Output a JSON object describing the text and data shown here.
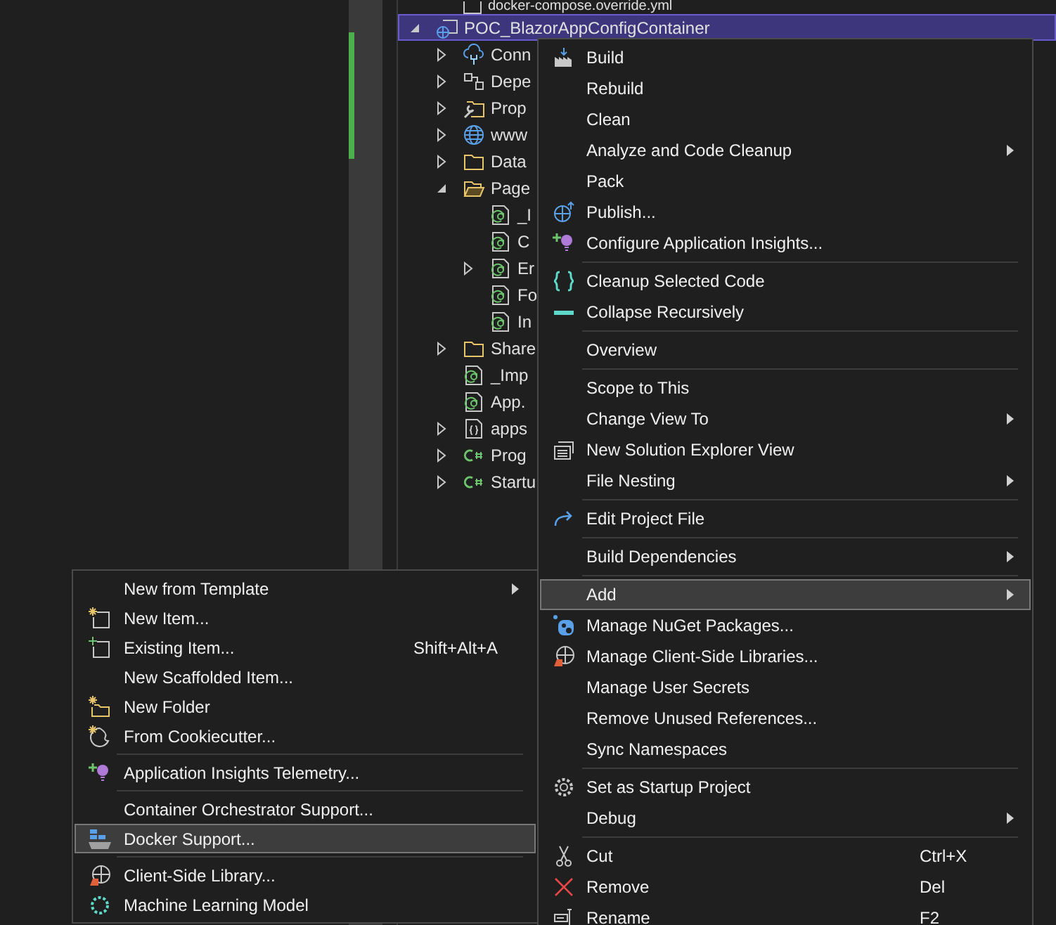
{
  "tree": {
    "items": [
      {
        "label": "docker-compose.override.yml",
        "kind": "yaml",
        "selected": false
      },
      {
        "label": "POC_BlazorAppConfigContainer",
        "kind": "project",
        "expanded": true,
        "selected": true,
        "children": [
          {
            "label": "Conn",
            "kind": "connected",
            "expanded": false,
            "selected": false
          },
          {
            "label": "Depe",
            "kind": "dependencies",
            "expanded": false,
            "selected": false
          },
          {
            "label": "Prop",
            "kind": "properties",
            "expanded": false,
            "selected": false
          },
          {
            "label": "www",
            "kind": "web",
            "expanded": false,
            "selected": false
          },
          {
            "label": "Data",
            "kind": "folder",
            "expanded": false,
            "selected": false
          },
          {
            "label": "Page",
            "kind": "folder-open",
            "expanded": true,
            "selected": false,
            "children": [
              {
                "label": "_I",
                "kind": "razor",
                "selected": false
              },
              {
                "label": "C",
                "kind": "razor",
                "selected": false
              },
              {
                "label": "Er",
                "kind": "razor",
                "expanded": false,
                "selected": false
              },
              {
                "label": "Fo",
                "kind": "razor",
                "selected": false
              },
              {
                "label": "In",
                "kind": "razor",
                "selected": false
              }
            ]
          },
          {
            "label": "Share",
            "kind": "folder",
            "expanded": false,
            "selected": false
          },
          {
            "label": "_Imp",
            "kind": "razor",
            "selected": false
          },
          {
            "label": "App.",
            "kind": "razor",
            "selected": false
          },
          {
            "label": "apps",
            "kind": "json",
            "expanded": false,
            "selected": false
          },
          {
            "label": "Prog",
            "kind": "csharp",
            "expanded": false,
            "selected": false
          },
          {
            "label": "Startu",
            "kind": "csharp",
            "expanded": false,
            "selected": false
          }
        ]
      }
    ]
  },
  "context_menu": {
    "items": [
      {
        "kind": "build",
        "label": "Build",
        "submenu": false,
        "selected": false
      },
      {
        "kind": "plain",
        "label": "Rebuild",
        "submenu": false,
        "selected": false
      },
      {
        "kind": "plain",
        "label": "Clean",
        "submenu": false,
        "selected": false
      },
      {
        "kind": "plain",
        "label": "Analyze and Code Cleanup",
        "submenu": true,
        "selected": false
      },
      {
        "kind": "plain",
        "label": "Pack",
        "submenu": false,
        "selected": false
      },
      {
        "kind": "publish",
        "label": "Publish...",
        "submenu": false,
        "selected": false
      },
      {
        "kind": "insights",
        "label": "Configure Application Insights...",
        "submenu": false,
        "selected": false
      },
      {
        "kind": "separator"
      },
      {
        "kind": "braces",
        "label": "Cleanup Selected Code",
        "submenu": false,
        "selected": false
      },
      {
        "kind": "collapse",
        "label": "Collapse Recursively",
        "submenu": false,
        "selected": false
      },
      {
        "kind": "separator"
      },
      {
        "kind": "plain",
        "label": "Overview",
        "submenu": false,
        "selected": false
      },
      {
        "kind": "separator"
      },
      {
        "kind": "plain",
        "label": "Scope to This",
        "submenu": false,
        "selected": false
      },
      {
        "kind": "plain",
        "label": "Change View To",
        "submenu": true,
        "selected": false
      },
      {
        "kind": "window",
        "label": "New Solution Explorer View",
        "submenu": false,
        "selected": false
      },
      {
        "kind": "plain",
        "label": "File Nesting",
        "submenu": true,
        "selected": false
      },
      {
        "kind": "separator"
      },
      {
        "kind": "edit",
        "label": "Edit Project File",
        "submenu": false,
        "selected": false
      },
      {
        "kind": "separator"
      },
      {
        "kind": "plain",
        "label": "Build Dependencies",
        "submenu": true,
        "selected": false
      },
      {
        "kind": "separator"
      },
      {
        "kind": "plain",
        "label": "Add",
        "submenu": true,
        "selected": true
      },
      {
        "kind": "nuget",
        "label": "Manage NuGet Packages...",
        "submenu": false,
        "selected": false
      },
      {
        "kind": "library",
        "label": "Manage Client-Side Libraries...",
        "submenu": false,
        "selected": false
      },
      {
        "kind": "plain",
        "label": "Manage User Secrets",
        "submenu": false,
        "selected": false
      },
      {
        "kind": "plain",
        "label": "Remove Unused References...",
        "submenu": false,
        "selected": false
      },
      {
        "kind": "plain",
        "label": "Sync Namespaces",
        "submenu": false,
        "selected": false
      },
      {
        "kind": "separator"
      },
      {
        "kind": "gear",
        "label": "Set as Startup Project",
        "submenu": false,
        "selected": false
      },
      {
        "kind": "plain",
        "label": "Debug",
        "submenu": true,
        "selected": false
      },
      {
        "kind": "separator"
      },
      {
        "kind": "cut",
        "label": "Cut",
        "shortcut": "Ctrl+X",
        "submenu": false,
        "selected": false
      },
      {
        "kind": "remove",
        "label": "Remove",
        "shortcut": "Del",
        "submenu": false,
        "selected": false
      },
      {
        "kind": "rename",
        "label": "Rename",
        "shortcut": "F2",
        "submenu": false,
        "selected": false
      }
    ]
  },
  "add_submenu": {
    "items": [
      {
        "kind": "plain",
        "label": "New from Template",
        "submenu": true,
        "selected": false
      },
      {
        "kind": "new-item",
        "label": "New Item...",
        "submenu": false,
        "selected": false
      },
      {
        "kind": "existing-item",
        "label": "Existing Item...",
        "shortcut": "Shift+Alt+A",
        "submenu": false,
        "selected": false
      },
      {
        "kind": "plain",
        "label": "New Scaffolded Item...",
        "submenu": false,
        "selected": false
      },
      {
        "kind": "new-folder",
        "label": "New Folder",
        "submenu": false,
        "selected": false
      },
      {
        "kind": "cookie",
        "label": "From Cookiecutter...",
        "submenu": false,
        "selected": false
      },
      {
        "kind": "separator"
      },
      {
        "kind": "insights",
        "label": "Application Insights Telemetry...",
        "submenu": false,
        "selected": false
      },
      {
        "kind": "separator"
      },
      {
        "kind": "plain",
        "label": "Container Orchestrator Support...",
        "submenu": false,
        "selected": false
      },
      {
        "kind": "docker",
        "label": "Docker Support...",
        "submenu": false,
        "selected": true
      },
      {
        "kind": "separator"
      },
      {
        "kind": "library",
        "label": "Client-Side Library...",
        "submenu": false,
        "selected": false
      },
      {
        "kind": "ml",
        "label": "Machine Learning Model",
        "submenu": false,
        "selected": false
      }
    ]
  }
}
